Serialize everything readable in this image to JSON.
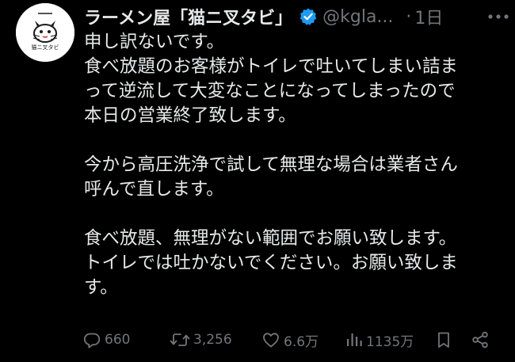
{
  "colors": {
    "background": "#000000",
    "text": "#e7e9ea",
    "secondary": "#71767b",
    "verified": "#1d9bf0"
  },
  "tweet": {
    "display_name": "ラーメン屋「猫ニ叉タビ」",
    "verified_icon": "verified-badge-icon",
    "handle": "@kgla...",
    "separator": "·",
    "time": "1日",
    "more_icon": "more-options-icon",
    "body_lines": [
      "申し訳ないです。",
      "食べ放題のお客様がトイレで吐いてしまい詰ま",
      "って逆流して大変なことになってしまったので",
      "本日の営業終了致します。",
      "",
      "今から高圧洗浄で試して無理な場合は業者さん",
      "呼んで直します。",
      "",
      "食べ放題、無理がない範囲でお願い致します。",
      "トイレでは吐かないでください。お願い致しま",
      "す。"
    ]
  },
  "actions": {
    "reply": {
      "icon": "reply-icon",
      "count": "660"
    },
    "retweet": {
      "icon": "retweet-icon",
      "count": "3,256"
    },
    "like": {
      "icon": "heart-icon",
      "count": "6.6万"
    },
    "views": {
      "icon": "views-icon",
      "count": "1135万"
    },
    "bookmark": {
      "icon": "bookmark-icon"
    },
    "share": {
      "icon": "share-icon"
    }
  }
}
